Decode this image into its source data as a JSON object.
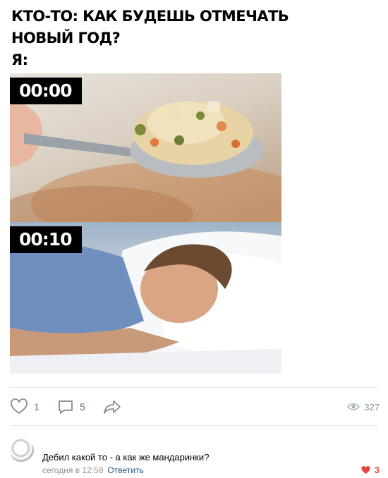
{
  "meme": {
    "line1": "КТО-ТО: КАК БУДЕШЬ ОТМЕЧАТЬ",
    "line2": "НОВЫЙ ГОД?",
    "line3": "Я:",
    "time_top": "00:00",
    "time_bottom": "00:10"
  },
  "post_actions": {
    "likes": "1",
    "comments": "5",
    "views": "327"
  },
  "comment": {
    "author": "",
    "text": "Дебил какой то - а как же мандаринки?",
    "date": "сегодня в 12:58",
    "reply_label": "Ответить",
    "likes": "3"
  },
  "colors": {
    "link": "#2a5885",
    "like_active": "#e64646",
    "icon": "#818c99"
  },
  "icons": [
    "heart-icon",
    "comment-icon",
    "share-icon",
    "eye-icon"
  ]
}
